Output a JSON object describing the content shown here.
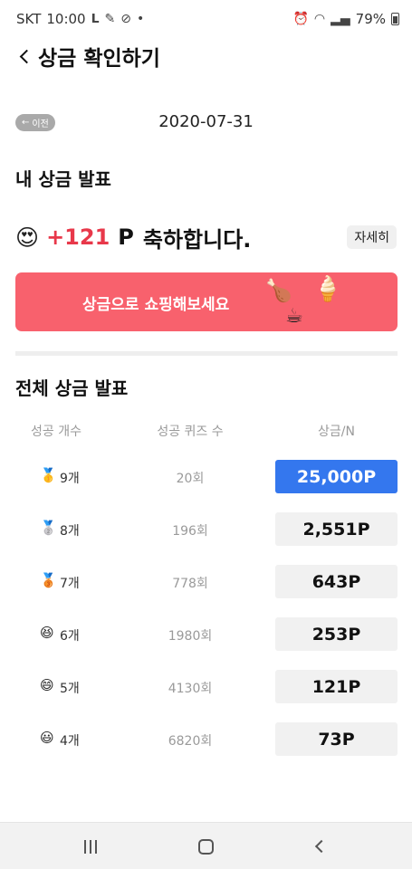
{
  "status_bar": {
    "carrier": "SKT",
    "time": "10:00",
    "battery": "79%"
  },
  "header": {
    "title": "상금 확인하기"
  },
  "date_nav": {
    "prev_label": "이전",
    "date": "2020-07-31"
  },
  "my_prize": {
    "section_title": "내 상금 발표",
    "emoji": "😍",
    "points": "+121",
    "unit": "P",
    "message": "축하합니다.",
    "detail_button": "자세히"
  },
  "banner": {
    "text": "상금으로 쇼핑해보세요",
    "icons": [
      "🍗",
      "🍦",
      "☕"
    ],
    "color": "#f8616d"
  },
  "all_prizes": {
    "section_title": "전체 상금 발표",
    "headers": [
      "성공 개수",
      "성공 퀴즈 수",
      "상금/N"
    ],
    "rows": [
      {
        "icon": "🥇",
        "count": "9개",
        "quiz_count": "20회",
        "prize": "25,000P"
      },
      {
        "icon": "🥈",
        "count": "8개",
        "quiz_count": "196회",
        "prize": "2,551P"
      },
      {
        "icon": "🥉",
        "count": "7개",
        "quiz_count": "778회",
        "prize": "643P"
      },
      {
        "icon": "😆",
        "count": "6개",
        "quiz_count": "1980회",
        "prize": "253P"
      },
      {
        "icon": "😄",
        "count": "5개",
        "quiz_count": "4130회",
        "prize": "121P"
      },
      {
        "icon": "😃",
        "count": "4개",
        "quiz_count": "6820회",
        "prize": "73P"
      }
    ],
    "highlight_color": "#3477ee"
  }
}
